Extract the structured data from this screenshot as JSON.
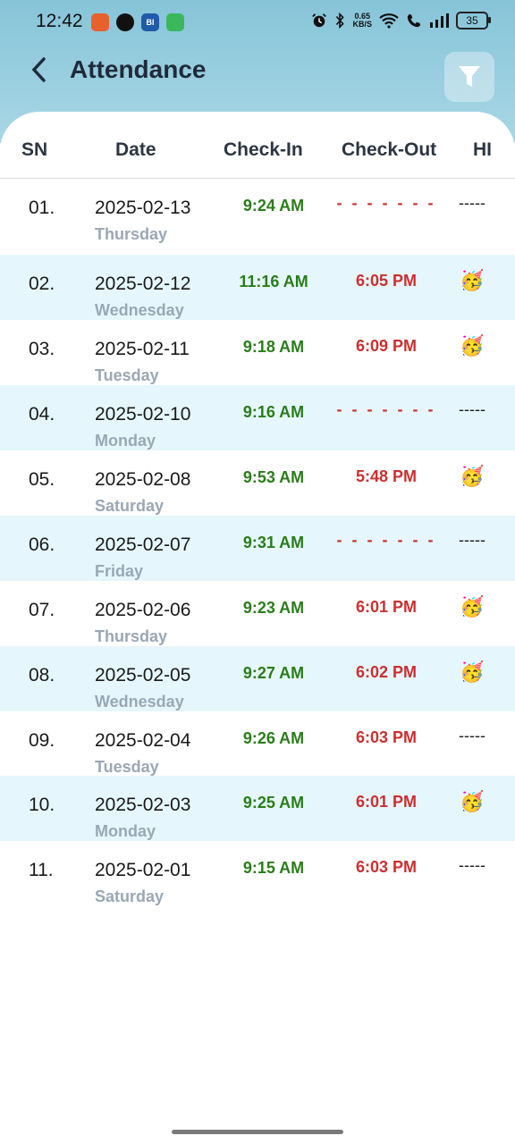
{
  "status_bar": {
    "time": "12:42",
    "app_icons": [
      {
        "name": "orange-app-icon",
        "label": "",
        "color": "#e8602c"
      },
      {
        "name": "snapchat-icon",
        "label": "👻",
        "color": "transparent"
      },
      {
        "name": "blue-app-icon",
        "label": "BI",
        "color": "#1f5ba8"
      },
      {
        "name": "green-app-icon",
        "label": "",
        "color": "#3bb85c"
      }
    ],
    "net_speed_value": "0.65",
    "net_speed_unit": "KB/S",
    "battery": "35"
  },
  "header": {
    "title": "Attendance"
  },
  "table": {
    "columns": [
      "SN",
      "Date",
      "Check-In",
      "Check-Out",
      "HI"
    ],
    "rows": [
      {
        "sn": "01.",
        "date": "2025-02-13",
        "day": "Thursday",
        "check_in": "9:24 AM",
        "check_out": "- - - - - - -",
        "hi": "-----"
      },
      {
        "sn": "02.",
        "date": "2025-02-12",
        "day": "Wednesday",
        "check_in": "11:16 AM",
        "check_out": "6:05 PM",
        "hi": "🥳"
      },
      {
        "sn": "03.",
        "date": "2025-02-11",
        "day": "Tuesday",
        "check_in": "9:18 AM",
        "check_out": "6:09 PM",
        "hi": "🥳"
      },
      {
        "sn": "04.",
        "date": "2025-02-10",
        "day": "Monday",
        "check_in": "9:16 AM",
        "check_out": "- - - - - - -",
        "hi": "-----"
      },
      {
        "sn": "05.",
        "date": "2025-02-08",
        "day": "Saturday",
        "check_in": "9:53 AM",
        "check_out": "5:48 PM",
        "hi": "🥳"
      },
      {
        "sn": "06.",
        "date": "2025-02-07",
        "day": "Friday",
        "check_in": "9:31 AM",
        "check_out": "- - - - - - -",
        "hi": "-----"
      },
      {
        "sn": "07.",
        "date": "2025-02-06",
        "day": "Thursday",
        "check_in": "9:23 AM",
        "check_out": "6:01 PM",
        "hi": "🥳"
      },
      {
        "sn": "08.",
        "date": "2025-02-05",
        "day": "Wednesday",
        "check_in": "9:27 AM",
        "check_out": "6:02 PM",
        "hi": "🥳"
      },
      {
        "sn": "09.",
        "date": "2025-02-04",
        "day": "Tuesday",
        "check_in": "9:26 AM",
        "check_out": "6:03 PM",
        "hi": "-----"
      },
      {
        "sn": "10.",
        "date": "2025-02-03",
        "day": "Monday",
        "check_in": "9:25 AM",
        "check_out": "6:01 PM",
        "hi": "🥳"
      },
      {
        "sn": "11.",
        "date": "2025-02-01",
        "day": "Saturday",
        "check_in": "9:15 AM",
        "check_out": "6:03 PM",
        "hi": "-----"
      }
    ]
  },
  "colors": {
    "header_gradient_top": "#87c4d8",
    "row_alt": "#e5f7fd",
    "check_in": "#2a7d1a",
    "check_out": "#cc2f2f",
    "day_text": "#9aa7b5"
  }
}
